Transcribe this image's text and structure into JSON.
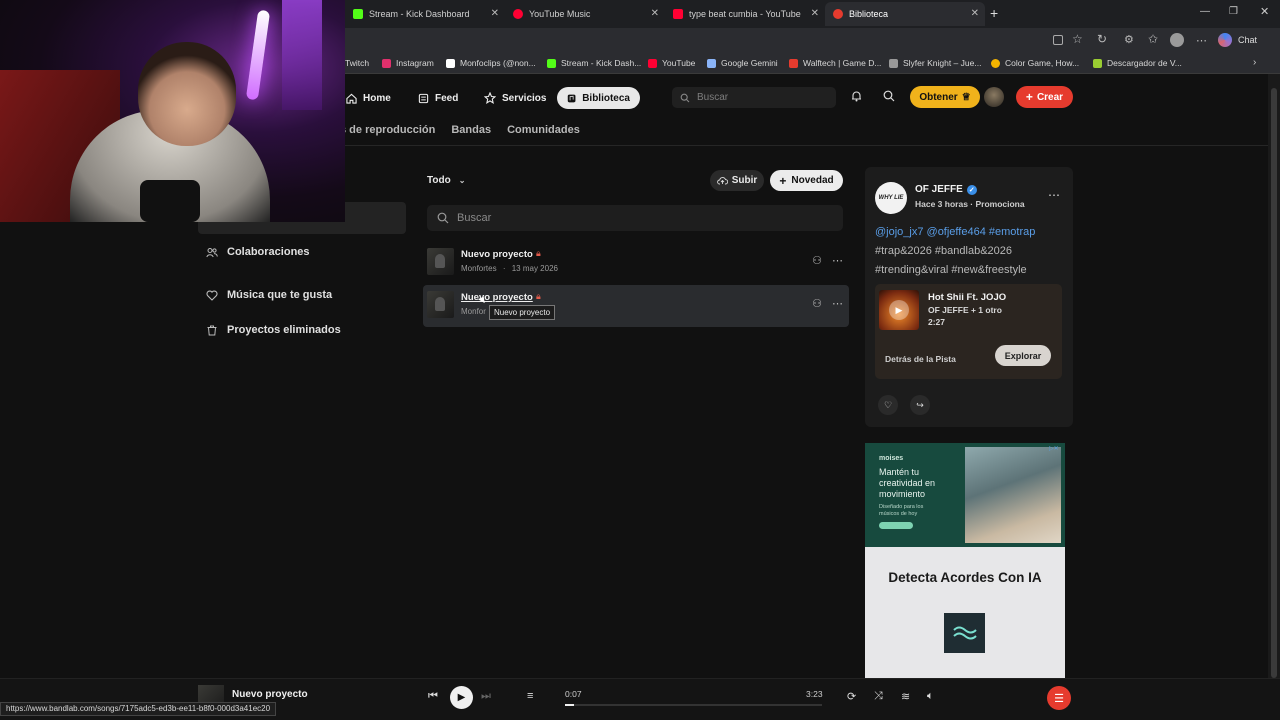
{
  "browser": {
    "tabs": [
      {
        "label": "Stream - Kick Dashboard",
        "color": "#53fc18"
      },
      {
        "label": "YouTube Music",
        "color": "#ff0033"
      },
      {
        "label": "type beat cumbia - YouTube",
        "color": "#ff0033"
      },
      {
        "label": "Biblioteca",
        "color": "#e63b2e"
      }
    ],
    "new_tab": "+",
    "bookmarks": [
      {
        "label": "Twitch",
        "color": "#9146ff"
      },
      {
        "label": "Instagram",
        "color": "#e1306c"
      },
      {
        "label": "Monfoclips (@non...",
        "color": "#ffffff"
      },
      {
        "label": "Stream - Kick Dash...",
        "color": "#53fc18"
      },
      {
        "label": "YouTube",
        "color": "#ff0033"
      },
      {
        "label": "Google Gemini",
        "color": "#8ab4f8"
      },
      {
        "label": "Walftech | Game D...",
        "color": "#e63b2e"
      },
      {
        "label": "Slyfer Knight – Jue...",
        "color": "#999999"
      },
      {
        "label": "Color Game, How...",
        "color": "#f4b400"
      },
      {
        "label": "Descargador de V...",
        "color": "#9acd32"
      }
    ],
    "chat_label": "Chat"
  },
  "nav": {
    "home": "Home",
    "feed": "Feed",
    "servicios": "Servicios",
    "biblioteca": "Biblioteca",
    "search_placeholder": "Buscar",
    "obtener": "Obtener",
    "crear": "Crear"
  },
  "subnav": [
    "s de reproducción",
    "Bandas",
    "Comunidades"
  ],
  "sidebar": {
    "items": [
      {
        "label": "Colaboraciones",
        "icon": "people-icon"
      },
      {
        "label": "Música que te gusta",
        "icon": "heart-icon"
      },
      {
        "label": "Proyectos eliminados",
        "icon": "trash-icon"
      }
    ]
  },
  "library": {
    "filter": "Todo",
    "subir": "Subir",
    "novedad": "Novedad",
    "search_placeholder": "Buscar",
    "projects": [
      {
        "title": "Nuevo proyecto",
        "author": "Monfortes",
        "date": "13 may 2026"
      },
      {
        "title": "Nuevo proyecto",
        "author": "Monfor"
      }
    ],
    "tooltip": "Nuevo proyecto"
  },
  "feed_card": {
    "user": "OF JEFFE",
    "meta": "Hace 3 horas · Promociona",
    "avatar_text": "WHY LIE",
    "text_line1": "@jojo_jx7 @ofjeffe464 #emotrap",
    "text_line2": "#trap&2026 #bandlab&2026",
    "text_line3": "#trending&viral #new&freestyle",
    "track_title": "Hot Shii Ft. JOJO",
    "track_artist": "OF JEFFE + 1 otro",
    "track_duration": "2:27",
    "behind": "Detrás de la Pista",
    "explore": "Explorar"
  },
  "ad": {
    "brand": "moises",
    "headline": "Mantén tu creatividad en movimiento",
    "sub": "Diseñado para los músicos de hoy",
    "title": "Detecta Acordes Con IA"
  },
  "player": {
    "track": "Nuevo proyecto",
    "current": "0:07",
    "total": "3:23",
    "progress": 0.036
  },
  "status_url": "https://www.bandlab.com/songs/7175adc5-ed3b-ee11-b8f0-000d3a41ec20"
}
